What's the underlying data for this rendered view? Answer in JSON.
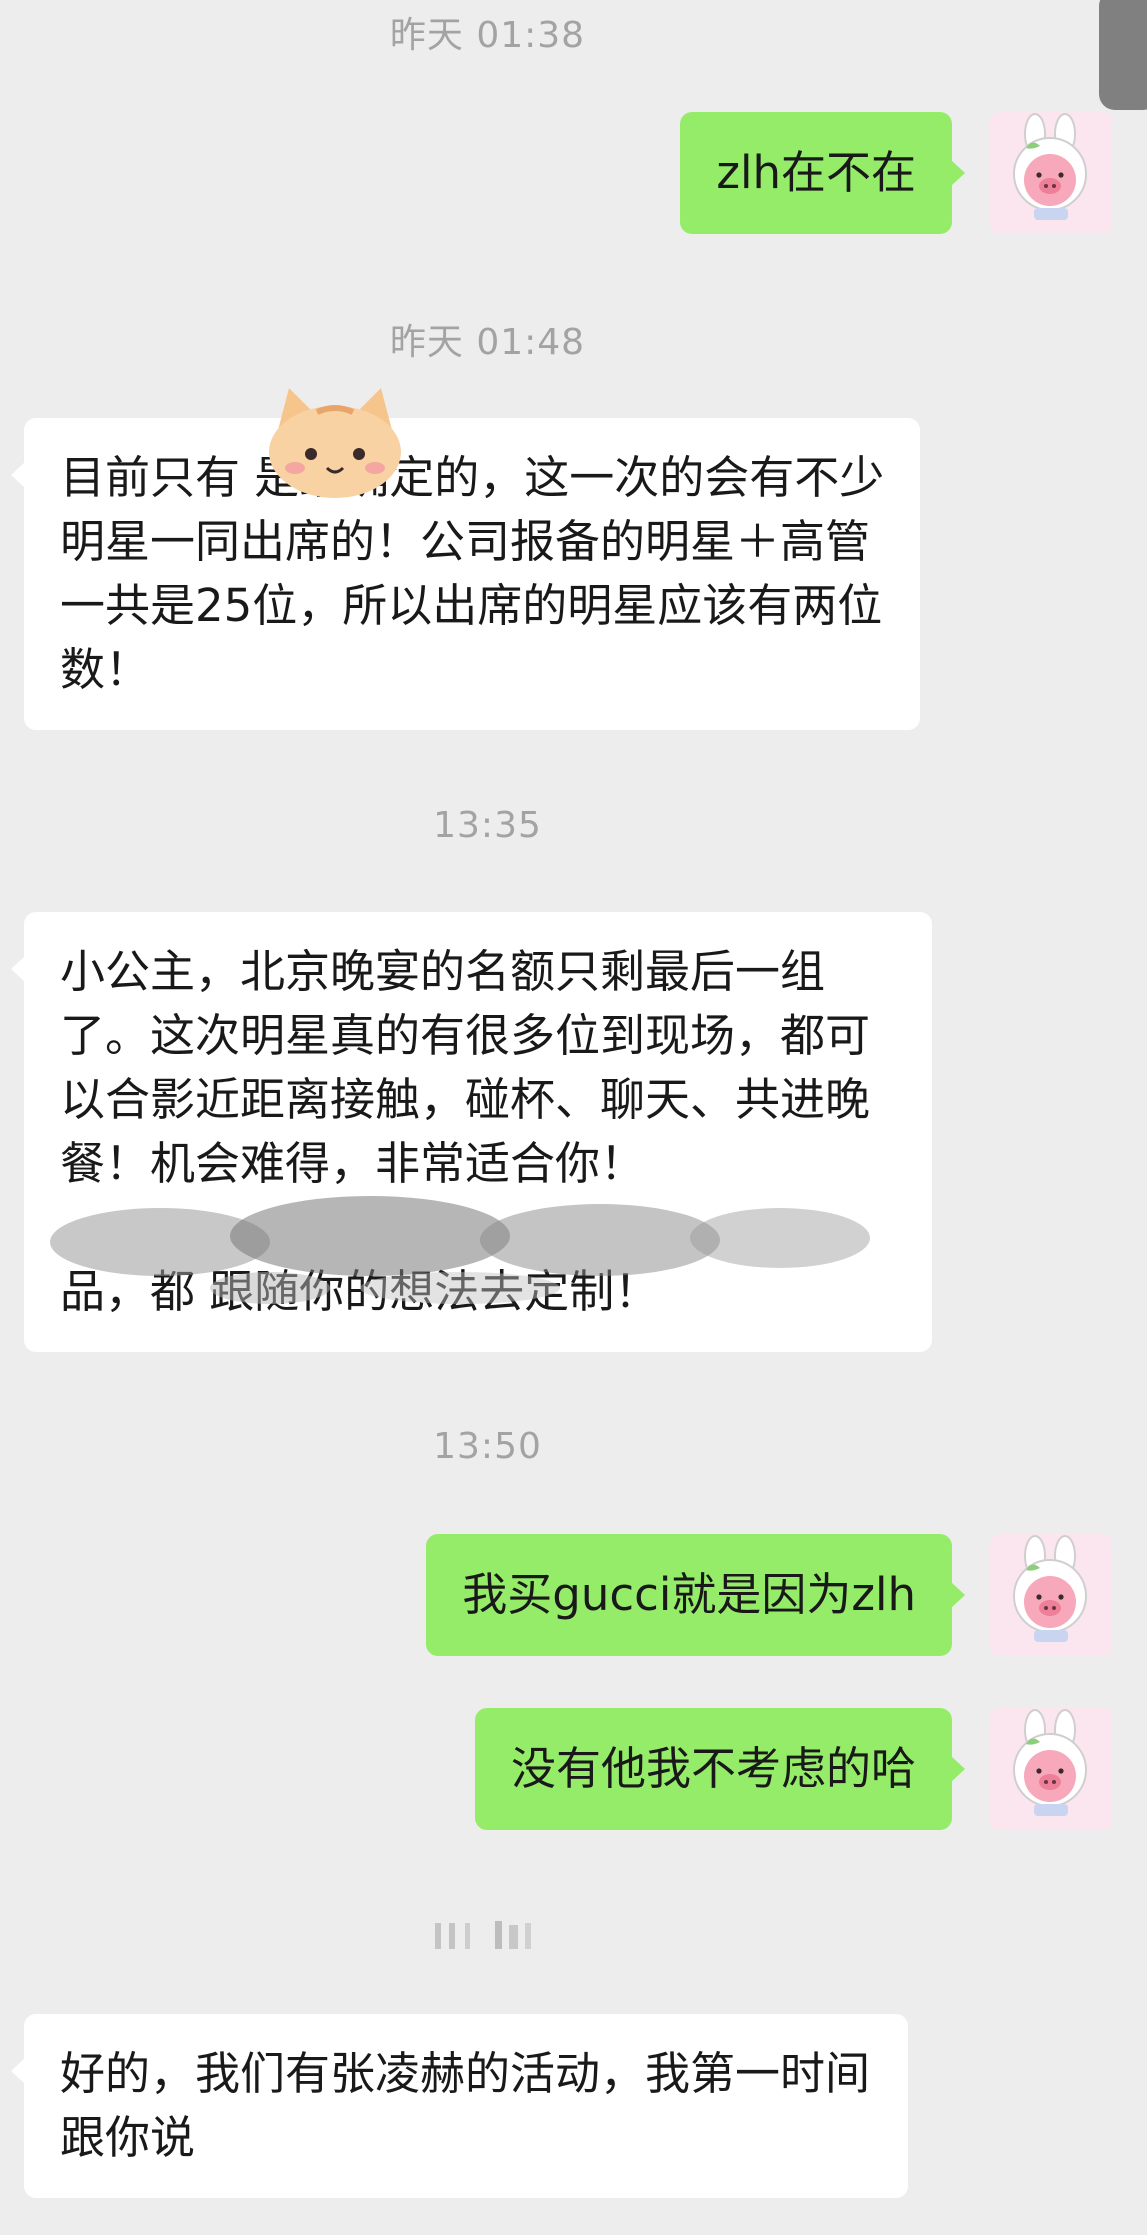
{
  "timestamps": {
    "t1": "昨天 01:38",
    "t2": "昨天 01:48",
    "t3": "13:35",
    "t4": "13:50"
  },
  "messages": {
    "out1": "zlh在不在",
    "in1": "目前只有  是最确定的，这一次的会有不少明星一同出席的！公司报备的明星＋高管一共是25位，所以出席的明星应该有两位数！",
    "in2_line1": "小公主，北京晚宴的名额只剩最后一组了。这次明星真的有很多位到现场，都可以合影近距离接触，碰杯、聊天、共进晚餐！机会难得，非常适合你！",
    "in2_line2": "品，都  跟随你的想法去定制！",
    "out2": "我买gucci就是因为zlh",
    "out3": "没有他我不考虑的哈",
    "in3": "好的，我们有张凌赫的活动，我第一时间跟你说"
  },
  "colors": {
    "background": "#ededed",
    "outgoing_bubble": "#95ec69",
    "incoming_bubble": "#ffffff",
    "timestamp_text": "#a3a3a3",
    "message_text": "#191919"
  },
  "icons": {
    "avatar": "pig-bunny-avatar",
    "sticker": "cat-face-sticker"
  }
}
